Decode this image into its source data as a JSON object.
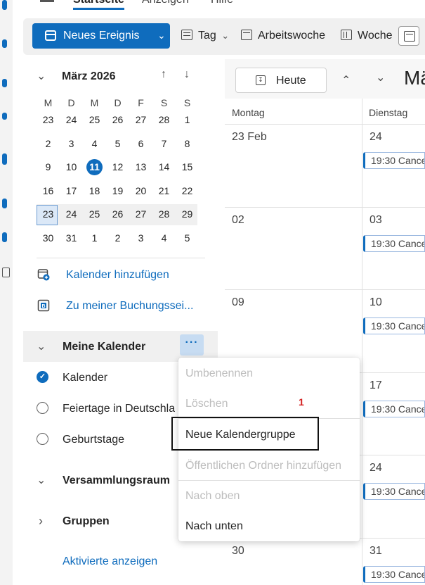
{
  "top_tabs": [
    "Startseite",
    "Anzeigen",
    "Hilfe"
  ],
  "toolbar": {
    "new_event": "Neues Ereignis",
    "day": "Tag",
    "work_week": "Arbeitswoche",
    "week": "Woche"
  },
  "mini_calendar": {
    "month": "März 2026",
    "weekdays": [
      "M",
      "D",
      "M",
      "D",
      "F",
      "S",
      "S"
    ],
    "weeks": [
      [
        "23",
        "24",
        "25",
        "26",
        "27",
        "28",
        "1"
      ],
      [
        "2",
        "3",
        "4",
        "5",
        "6",
        "7",
        "8"
      ],
      [
        "9",
        "10",
        "11",
        "12",
        "13",
        "14",
        "15"
      ],
      [
        "16",
        "17",
        "18",
        "19",
        "20",
        "21",
        "22"
      ],
      [
        "23",
        "24",
        "25",
        "26",
        "27",
        "28",
        "29"
      ],
      [
        "30",
        "31",
        "1",
        "2",
        "3",
        "4",
        "5"
      ]
    ],
    "today": "11",
    "selected_day": "23"
  },
  "links": {
    "add_calendar": "Kalender hinzufügen",
    "booking": "Zu meiner Buchungssei..."
  },
  "my_calendars": {
    "title": "Meine Kalender",
    "more": "···",
    "items": [
      "Kalender",
      "Feiertage in Deutschlan",
      "Geburtstage"
    ]
  },
  "groups": {
    "meeting_room": "Versammlungsraum",
    "groups": "Gruppen",
    "show_activated": "Aktivierte anzeigen"
  },
  "calendar_view": {
    "today_button": "Heute",
    "month_title": "Mär",
    "col_monday": "Montag",
    "col_tuesday": "Dienstag",
    "monday_dates": [
      "23 Feb",
      "02",
      "09",
      "",
      "",
      "30"
    ],
    "tuesday_dates": [
      "24",
      "03",
      "10",
      "17",
      "24",
      "31"
    ],
    "event_label": "19:30 Cance"
  },
  "context_menu": {
    "items": [
      {
        "label": "Umbenennen",
        "disabled": true
      },
      {
        "label": "Löschen",
        "disabled": true
      },
      {
        "label": "Neue Kalendergruppe",
        "disabled": false
      },
      {
        "label": "Öffentlichen Ordner hinzufügen",
        "disabled": true
      },
      {
        "label": "Nach oben",
        "disabled": true
      },
      {
        "label": "Nach unten",
        "disabled": false
      }
    ]
  },
  "annotation": "1",
  "colors": {
    "accent": "#0f6cbd",
    "annotation": "#d42020"
  }
}
